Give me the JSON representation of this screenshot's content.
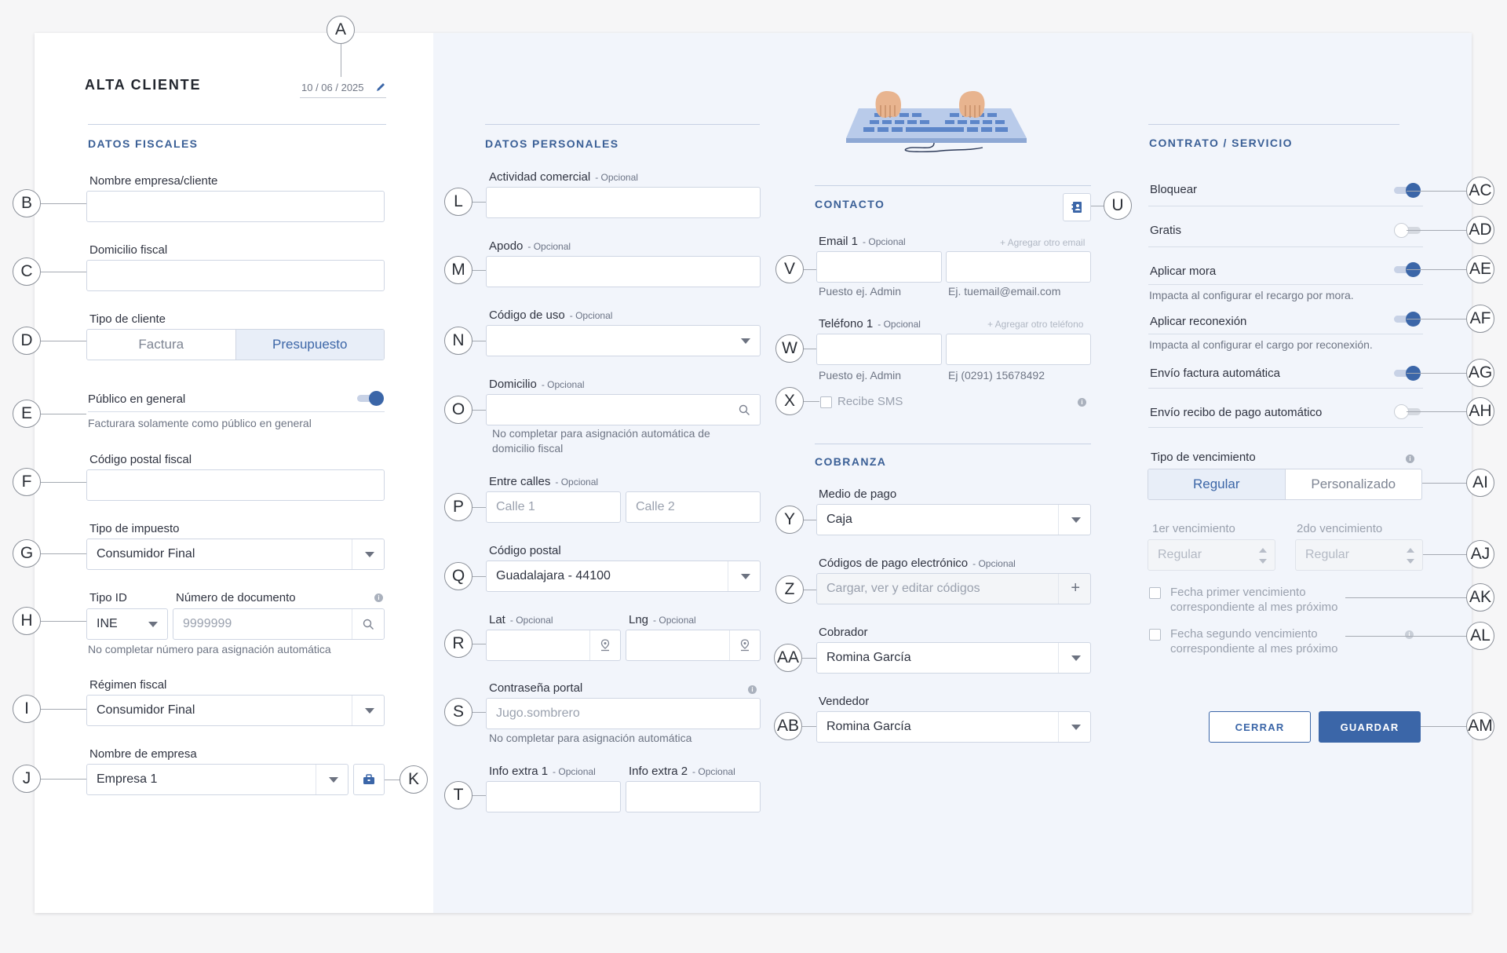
{
  "header": {
    "title": "ALTA CLIENTE",
    "date": "10 / 06 / 2025"
  },
  "callouts": [
    "A",
    "B",
    "C",
    "D",
    "E",
    "F",
    "G",
    "H",
    "I",
    "J",
    "K",
    "L",
    "M",
    "N",
    "O",
    "P",
    "Q",
    "R",
    "S",
    "T",
    "U",
    "V",
    "W",
    "X",
    "Y",
    "Z",
    "AA",
    "AB",
    "AC",
    "AD",
    "AE",
    "AF",
    "AG",
    "AH",
    "AI",
    "AJ",
    "AK",
    "AL",
    "AM"
  ],
  "fiscal": {
    "section": "DATOS FISCALES",
    "nombre_label": "Nombre empresa/cliente",
    "domicilio_label": "Domicilio fiscal",
    "tipo_cliente_label": "Tipo de cliente",
    "tipo_cliente_options": [
      "Factura",
      "Presupuesto"
    ],
    "tipo_cliente_selected": "Presupuesto",
    "publico_label": "Público en general",
    "publico_on": true,
    "publico_help": "Facturara solamente como público en general",
    "cp_label": "Código postal fiscal",
    "impuesto_label": "Tipo de impuesto",
    "impuesto_value": "Consumidor Final",
    "tipo_id_label": "Tipo ID",
    "tipo_id_value": "INE",
    "documento_label": "Número de documento",
    "documento_placeholder": "9999999",
    "documento_help": "No completar número para asignación automática",
    "regimen_label": "Régimen fiscal",
    "regimen_value": "Consumidor Final",
    "empresa_label": "Nombre de empresa",
    "empresa_value": "Empresa 1"
  },
  "personal": {
    "section": "DATOS PERSONALES",
    "optional": "- Opcional",
    "actividad_label": "Actividad comercial",
    "apodo_label": "Apodo",
    "codigo_uso_label": "Código de uso",
    "domicilio_label": "Domicilio",
    "domicilio_help": "No completar para asignación automática de domicilio fiscal",
    "entre_calles_label": "Entre calles",
    "calle1_placeholder": "Calle 1",
    "calle2_placeholder": "Calle 2",
    "cp_label": "Código postal",
    "cp_value": "Guadalajara - 44100",
    "lat_label": "Lat",
    "lng_label": "Lng",
    "password_label": "Contraseña portal",
    "password_placeholder": "Jugo.sombrero",
    "password_help": "No completar para asignación automática",
    "info1_label": "Info extra 1",
    "info2_label": "Info extra 2"
  },
  "contacto": {
    "section": "CONTACTO",
    "email_label": "Email 1",
    "add_email": "+ Agregar otro email",
    "email_help1": "Puesto ej. Admin",
    "email_help2": "Ej. tuemail@email.com",
    "telefono_label": "Teléfono 1",
    "add_phone": "+ Agregar otro teléfono",
    "tel_help1": "Puesto ej. Admin",
    "tel_help2": "Ej (0291) 15678492",
    "sms_label": "Recibe SMS"
  },
  "cobranza": {
    "section": "COBRANZA",
    "medio_label": "Medio de pago",
    "medio_value": "Caja",
    "codigos_label": "Códigos de pago electrónico",
    "codigos_placeholder": "Cargar, ver y editar códigos",
    "plus": "+",
    "cobrador_label": "Cobrador",
    "cobrador_value": "Romina García",
    "vendedor_label": "Vendedor",
    "vendedor_value": "Romina García"
  },
  "contrato": {
    "section": "CONTRATO / SERVICIO",
    "bloquear": "Bloquear",
    "bloquear_on": true,
    "gratis": "Gratis",
    "gratis_on": false,
    "mora": "Aplicar mora",
    "mora_on": true,
    "mora_help": "Impacta al configurar el recargo por mora.",
    "reconexion": "Aplicar reconexión",
    "reconexion_on": true,
    "reconexion_help": "Impacta al configurar el cargo por reconexión.",
    "envio_factura": "Envío factura automática",
    "envio_factura_on": true,
    "envio_recibo": "Envío recibo de pago automático",
    "envio_recibo_on": false,
    "vencimiento_label": "Tipo de vencimiento",
    "vencimiento_options": [
      "Regular",
      "Personalizado"
    ],
    "vencimiento_selected": "Regular",
    "venc1_label": "1er vencimiento",
    "venc2_label": "2do vencimiento",
    "venc_placeholder": "Regular",
    "fecha1_line1": "Fecha primer vencimiento",
    "fecha1_line2": "correspondiente al mes próximo",
    "fecha2_line1": "Fecha segundo vencimiento",
    "fecha2_line2": "correspondiente al mes próximo"
  },
  "actions": {
    "cerrar": "CERRAR",
    "guardar": "GUARDAR"
  },
  "colors": {
    "accent": "#3b66a8",
    "section": "#3a5f96",
    "panel": "#f2f5fb"
  }
}
